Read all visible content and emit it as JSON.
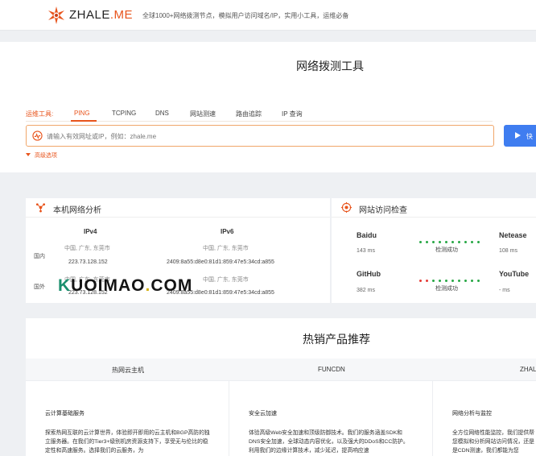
{
  "header": {
    "brand_main": "ZHALE",
    "brand_suffix": ".ME",
    "tagline": "全球1000+网络拨测节点，模拟用户访问域名/IP，实用小工具，运维必备"
  },
  "tool": {
    "title": "网络拨测工具",
    "tools_label": "运维工具:",
    "tabs": [
      "PING",
      "TCPING",
      "DNS",
      "网站测速",
      "路由追踪",
      "IP 查询"
    ],
    "active_tab": "PING",
    "search_placeholder": "请输入有效网址或IP，例如：zhale.me",
    "go_label": "快",
    "advanced_label": "高级选项"
  },
  "local_analysis": {
    "title": "本机网络分析",
    "columns": [
      "IPv4",
      "IPv6"
    ],
    "rows": [
      {
        "label": "国内",
        "ipv4_location": "中国, 广东, 东莞市",
        "ipv4": "223.73.128.152",
        "ipv6_location": "中国, 广东, 东莞市",
        "ipv6": "2409:8a55:d8e0:81d1:859:47e5:34cd:a855"
      },
      {
        "label": "国外",
        "ipv4_location": "中国, 广东, 东莞市",
        "ipv4": "223.73.128.152",
        "ipv6_location": "中国, 广东, 东莞市",
        "ipv6": "2409:8a55:d8e0:81d1:859:47e5:34cd:a855"
      }
    ]
  },
  "site_check": {
    "title": "网站访问检查",
    "sites": [
      {
        "name": "Baidu",
        "ms": "143 ms",
        "status": "检测成功",
        "dot_colors": [
          "#27a745",
          "#27a745",
          "#27a745",
          "#27a745",
          "#27a745",
          "#27a745",
          "#27a745",
          "#27a745",
          "#27a745",
          "#27a745"
        ]
      },
      {
        "name": "Netease",
        "ms": "108 ms"
      },
      {
        "name": "GitHub",
        "ms": "382 ms",
        "status": "检测成功",
        "dot_colors": [
          "#e53935",
          "#e53935",
          "#27a745",
          "#27a745",
          "#27a745",
          "#27a745",
          "#27a745",
          "#27a745",
          "#27a745",
          "#27a745"
        ]
      },
      {
        "name": "YouTube",
        "ms": "- ms"
      }
    ]
  },
  "watermark": {
    "k": "K",
    "rest": "UOIMAO",
    "dot": ".",
    "com": "COM"
  },
  "products": {
    "title": "热销产品推荐",
    "tabs": [
      "热网云主机",
      "FUNCDN",
      "ZHAL"
    ],
    "cards": [
      {
        "title": "云计算基础服务",
        "desc": "探索热网互联的云计算世界，体验即开即用的云主机和BGP高防的独立服务器。在我们的Tier3+级别机房资源支持下，享受无与伦比的稳定性和高速服务。选择我们的云服务，为"
      },
      {
        "title": "安全云加速",
        "desc": "体验高级Web安全加速和顶级防御技术。我们的服务涵盖SDK和DNS安全加速，全球动态内容优化，以及强大的DDoS和CC防护。利用我们的边缘计算技术，减少延迟，提高响应速"
      },
      {
        "title": "网络分析与监控",
        "desc": "全方位网络性能监控，我们提供帮您模拟和分析网站访问情况，还是是CDN测速，我们都能为您"
      }
    ]
  }
}
